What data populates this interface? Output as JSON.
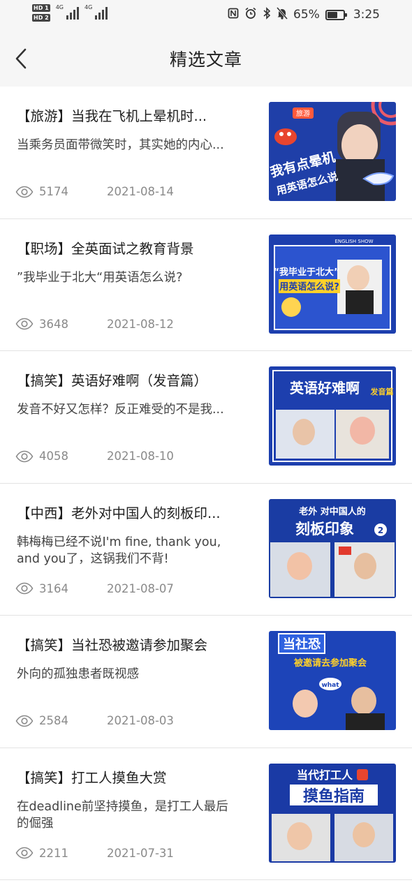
{
  "status_bar": {
    "battery_percent": "65%",
    "time": "3:25",
    "network": "4G",
    "hd1": "HD 1",
    "hd2": "HD 2"
  },
  "nav": {
    "title": "精选文章"
  },
  "articles": [
    {
      "title": "【旅游】当我在飞机上晕机时...",
      "desc": "当乘务员面带微笑时，其实她的内心...",
      "views": "5174",
      "date": "2021-08-14",
      "thumb": {
        "bg": "#1f3fa8",
        "line1": "我有点晕机",
        "line2": "用英语怎么说",
        "tag": "旅游"
      }
    },
    {
      "title": "【职场】全英面试之教育背景",
      "desc": "”我毕业于北大“用英语怎么说?",
      "views": "3648",
      "date": "2021-08-12",
      "thumb": {
        "bg": "#1d3fae",
        "line1": "“我毕业于北大”",
        "line2": "用英语怎么说?",
        "tag": "ENGLISH SHOW"
      }
    },
    {
      "title": "【搞笑】英语好难啊（发音篇）",
      "desc": "发音不好又怎样？反正难受的不是我...",
      "views": "4058",
      "date": "2021-08-10",
      "thumb": {
        "bg": "#1d3fae",
        "line1": "英语好难啊",
        "line2": "发音篇",
        "tag": ""
      }
    },
    {
      "title": "【中西】老外对中国人的刻板印...",
      "desc": "韩梅梅已经不说I'm fine, thank you, and you了，这锅我们不背!",
      "views": "3164",
      "date": "2021-08-07",
      "thumb": {
        "bg": "#1a3ca3",
        "line1": "老外 对中国人的",
        "line2": "刻板印象",
        "tag": "2"
      }
    },
    {
      "title": "【搞笑】当社恐被邀请参加聚会",
      "desc": "外向的孤独患者既视感",
      "views": "2584",
      "date": "2021-08-03",
      "thumb": {
        "bg": "#1d44b8",
        "line1": "当社恐",
        "line2": "被邀请去参加聚会",
        "tag": "what"
      }
    },
    {
      "title": "【搞笑】打工人摸鱼大赏",
      "desc": "在deadline前坚持摸鱼，是打工人最后的倔强",
      "views": "2211",
      "date": "2021-07-31",
      "thumb": {
        "bg": "#1a3aa5",
        "line1": "当代打工人",
        "line2": "摸鱼指南",
        "tag": ""
      }
    }
  ]
}
